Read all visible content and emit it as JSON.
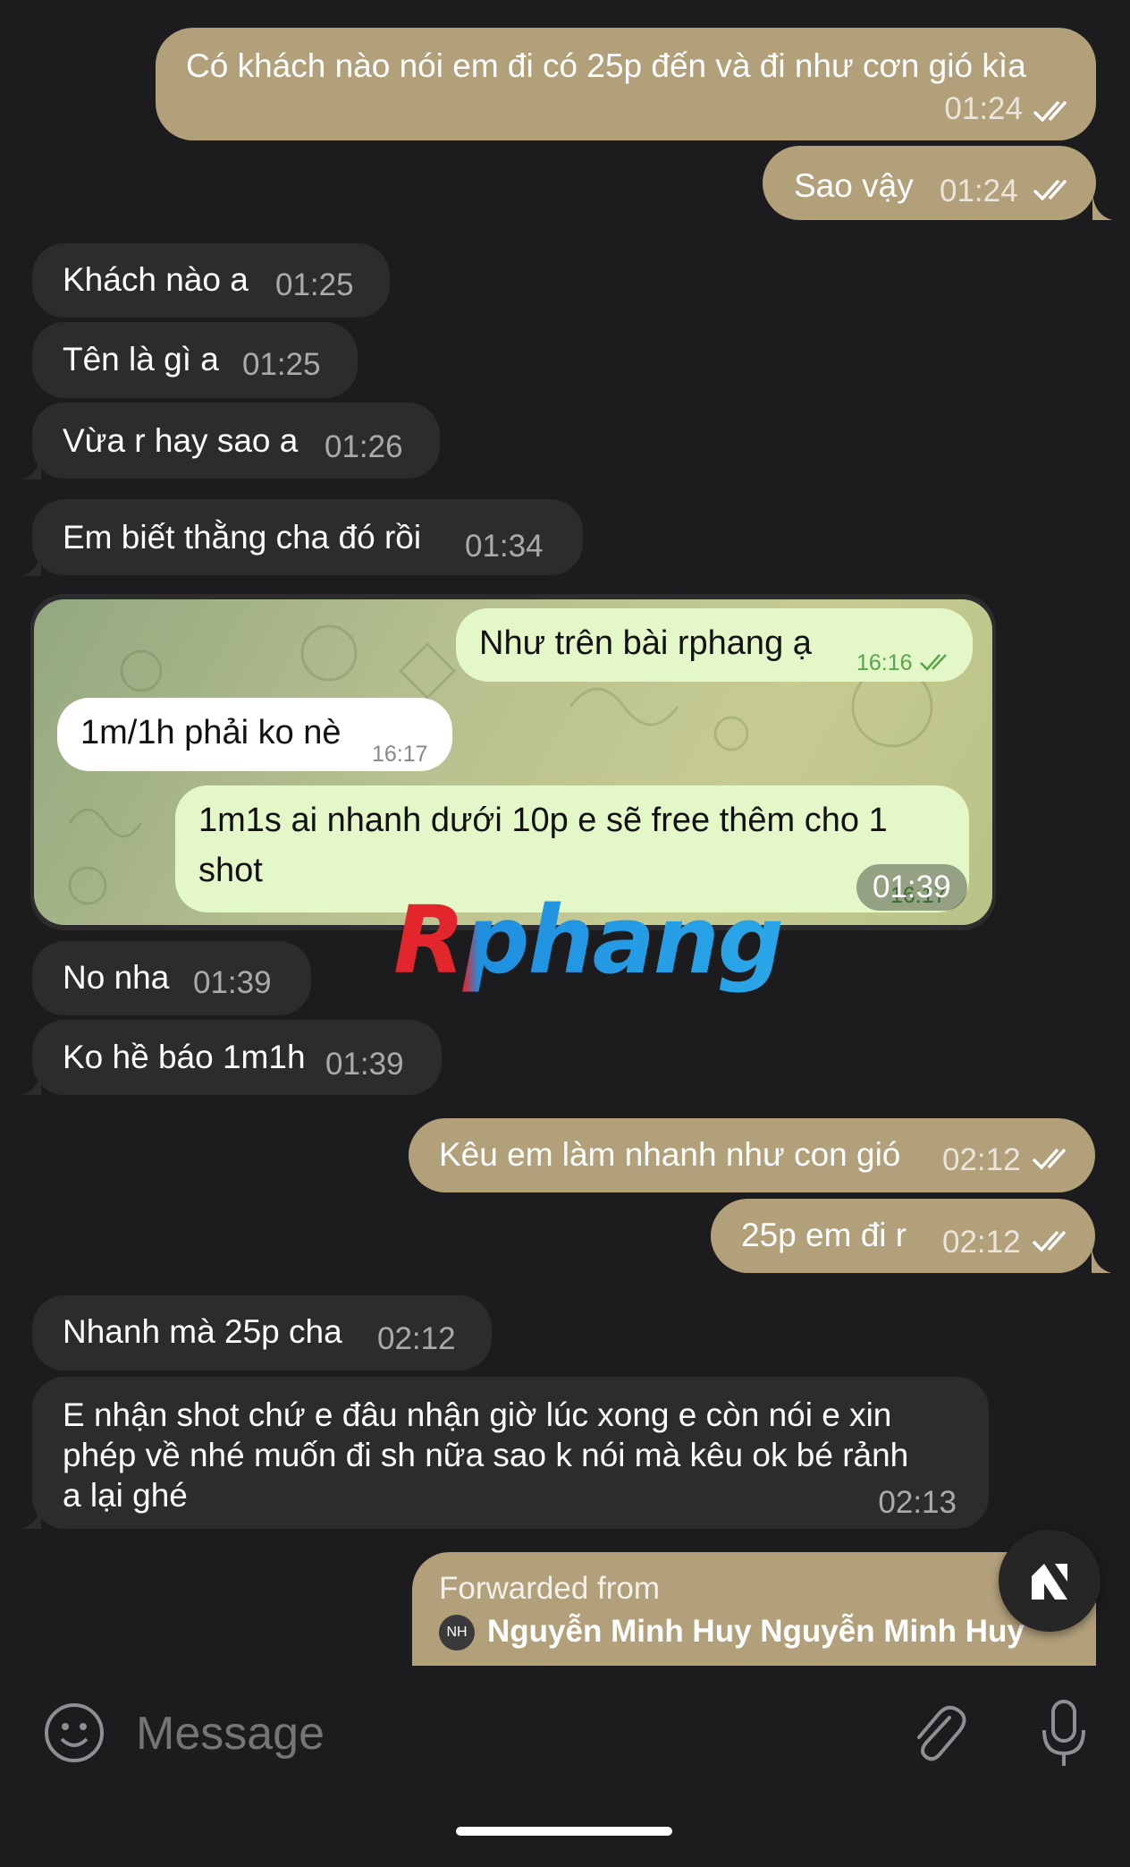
{
  "messages": [
    {
      "id": "m1",
      "dir": "out",
      "text": "Có khách nào nói em đi có 25p đến và đi như cơn gió kìa",
      "time": "01:24"
    },
    {
      "id": "m2",
      "dir": "out",
      "text": "Sao vậy",
      "time": "01:24"
    },
    {
      "id": "m3",
      "dir": "in",
      "text": "Khách nào a",
      "time": "01:25"
    },
    {
      "id": "m4",
      "dir": "in",
      "text": "Tên là gì a",
      "time": "01:25"
    },
    {
      "id": "m5",
      "dir": "in",
      "text": "Vừa r hay sao a",
      "time": "01:26"
    },
    {
      "id": "m6",
      "dir": "in",
      "text": "Em biết thằng cha đó rồi",
      "time": "01:34"
    },
    {
      "id": "m8",
      "dir": "in",
      "text": "No nha",
      "time": "01:39"
    },
    {
      "id": "m9",
      "dir": "in",
      "text": "Ko hề báo 1m1h",
      "time": "01:39"
    },
    {
      "id": "m10",
      "dir": "out",
      "text": "Kêu em làm nhanh như con gió",
      "time": "02:12"
    },
    {
      "id": "m11",
      "dir": "out",
      "text": "25p em đi r",
      "time": "02:12"
    },
    {
      "id": "m12",
      "dir": "in",
      "text": "Nhanh mà 25p cha",
      "time": "02:12"
    },
    {
      "id": "m13",
      "dir": "in",
      "lines": [
        "E nhận shot chứ e đâu nhận giờ lúc xong e còn nói e xin",
        "phép về nhé muốn đi sh nữa sao k nói mà kêu ok bé rảnh",
        "a lại ghé"
      ],
      "time": "02:13"
    }
  ],
  "screenshot": {
    "time": "01:39",
    "bubbles": [
      {
        "dir": "out",
        "text": "Như trên bài rphang ạ",
        "time": "16:16"
      },
      {
        "dir": "in",
        "text": "1m/1h phải ko nè",
        "time": "16:17"
      },
      {
        "dir": "out",
        "lines": [
          "1m1s ai nhanh dưới 10p e sẽ free thêm cho 1",
          "shot"
        ],
        "time": "16:17"
      }
    ]
  },
  "watermark": "Rphang",
  "forwarded": {
    "label": "Forwarded from",
    "avatar_initials": "NH",
    "sender": "Nguyễn Minh Huy Nguyễn Minh Huy"
  },
  "input": {
    "placeholder": "Message"
  },
  "icons": {
    "emoji": "emoji-icon",
    "attach": "paperclip-icon",
    "mic": "microphone-icon",
    "float": "app-logo-icon",
    "read": "double-check-icon"
  },
  "colors": {
    "outgoing": "#b2a07b",
    "incoming": "#2c2c2e",
    "background": "#1c1c1e"
  }
}
